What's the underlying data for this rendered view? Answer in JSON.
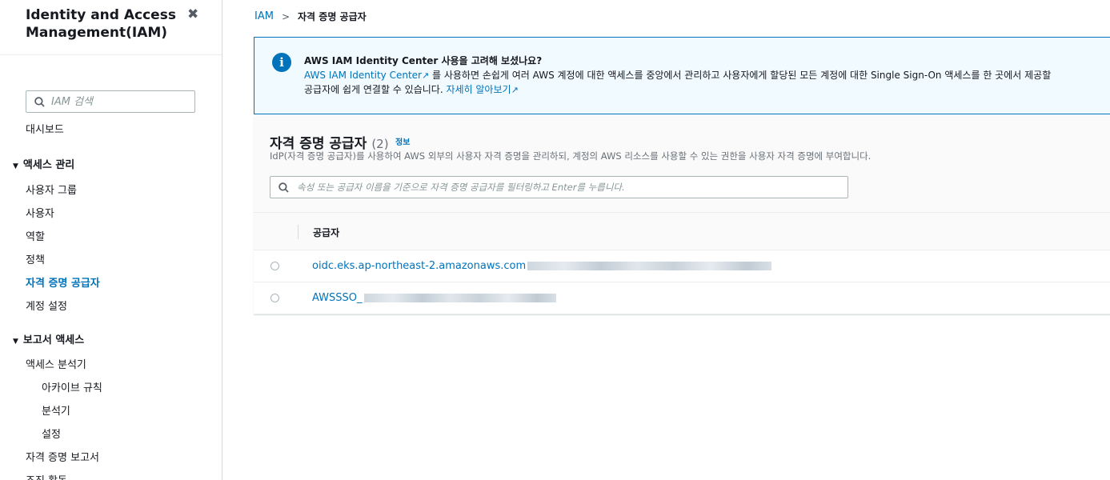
{
  "sidebar": {
    "title": "Identity and Access Management(IAM)",
    "close_icon": "✖",
    "search_placeholder": "IAM 검색",
    "items": {
      "dashboard": "대시보드",
      "user_groups": "사용자 그룹",
      "users": "사용자",
      "roles": "역할",
      "policies": "정책",
      "identity_providers": "자격 증명 공급자",
      "account_settings": "계정 설정",
      "access_analyzer": "액세스 분석기",
      "archive_rules": "아카이브 규칙",
      "analyzers": "분석기",
      "settings": "설정",
      "credential_report": "자격 증명 보고서",
      "org_activity": "조직 활동"
    },
    "sections": {
      "access_management": "액세스 관리",
      "access_reports": "보고서 액세스"
    }
  },
  "breadcrumb": {
    "root": "IAM",
    "current": "자격 증명 공급자"
  },
  "info_banner": {
    "title": "AWS IAM Identity Center 사용을 고려해 보셨나요?",
    "link1": "AWS IAM Identity Center",
    "line1_rest": " 를 사용하면 손쉽게 여러 AWS 계정에 대한 액세스를 중앙에서 관리하고 사용자에게 할당된 모든 계정에 대한 Single Sign-On 액세스를 한 곳에서 제공할",
    "line2_start": "공급자에 쉽게 연결할 수 있습니다. ",
    "link2": "자세히 알아보기"
  },
  "panel": {
    "title": "자격 증명 공급자",
    "count": "(2)",
    "info_label": "정보",
    "description": "IdP(자격 증명 공급자)를 사용하여 AWS 외부의 사용자 자격 증명을 관리하되, 계정의 AWS 리소스를 사용할 수 있는 권한을 사용자 자격 증명에 부여합니다.",
    "filter_placeholder": "속성 또는 공급자 이름을 기준으로 자격 증명 공급자를 필터링하고 Enter를 누릅니다.",
    "column_header": "공급자",
    "rows": [
      {
        "provider": "oidc.eks.ap-northeast-2.amazonaws.com"
      },
      {
        "provider": "AWSSSO_"
      }
    ]
  },
  "colors": {
    "link": "#0073bb",
    "text": "#16191f",
    "info_bg": "#f1faff"
  },
  "icons": {
    "search": "search-icon",
    "info": "info-icon",
    "close": "close-icon",
    "external": "external-link-icon"
  }
}
